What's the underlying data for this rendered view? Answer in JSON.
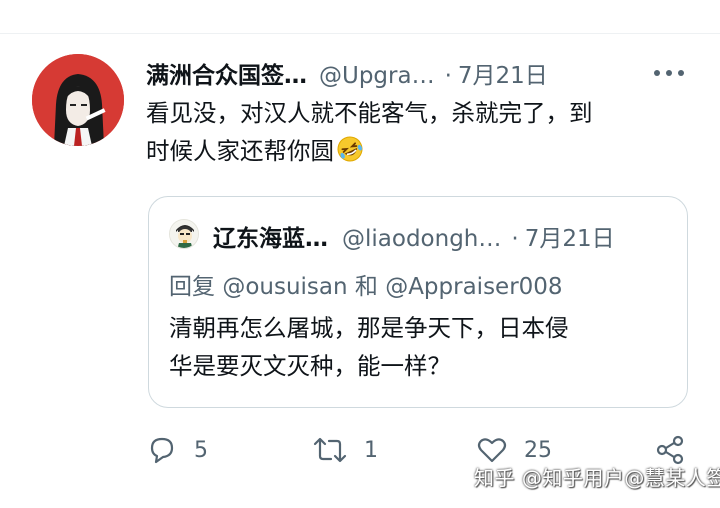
{
  "tweet": {
    "author_name": "满洲合众国签…",
    "handle": "@Upgra…",
    "separator": "·",
    "date": "7月21日",
    "text_line1": "看见没，对汉人就不能客气，杀就完了，到",
    "text_line2": "时候人家还帮你圆",
    "emoji_icon": "rofl-emoji"
  },
  "quoted_tweet": {
    "author_name": "辽东海蓝…",
    "handle": "@liaodongh…",
    "separator": "·",
    "date": "7月21日",
    "reply_prefix": "回复",
    "reply_mention1": "@ousuisan",
    "reply_and": "和",
    "reply_mention2": "@Appraiser008",
    "text_line1": "清朝再怎么屠城，那是争天下，日本侵",
    "text_line2": "华是要灭文灭种，能一样？"
  },
  "actions": {
    "reply_count": "5",
    "retweet_count": "1",
    "like_count": "25"
  },
  "watermark": "知乎 @知乎用户@慧某人签",
  "colors": {
    "text": "#0f1419",
    "secondary": "#536471",
    "border": "#cfd9de",
    "avatar_bg": "#d63a34"
  }
}
